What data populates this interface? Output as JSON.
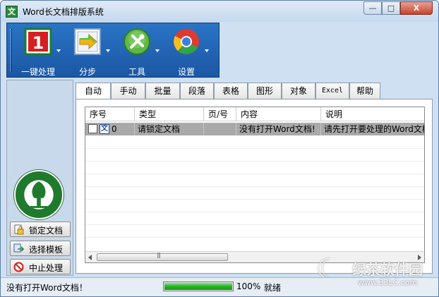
{
  "window": {
    "title": "Word长文档排版系统",
    "app_icon_glyph": "文",
    "controls": {
      "minimize": "—",
      "maximize": "□",
      "close": "X"
    }
  },
  "toolbar": {
    "items": [
      {
        "label": "一键处理",
        "icon": "one-key-icon",
        "icon_text": "1"
      },
      {
        "label": "分步",
        "icon": "step-arrow-icon"
      },
      {
        "label": "工具",
        "icon": "tools-icon"
      },
      {
        "label": "设置",
        "icon": "settings-globe-icon"
      }
    ]
  },
  "left_panel": {
    "logo": "forestry-academy-logo",
    "buttons": [
      {
        "label": "锁定文档",
        "icon": "lock-doc-icon"
      },
      {
        "label": "选择模板",
        "icon": "select-template-icon"
      },
      {
        "label": "中止处理",
        "icon": "stop-icon"
      }
    ]
  },
  "tabs": [
    "自动",
    "手动",
    "批量",
    "段落",
    "表格",
    "图形",
    "对象",
    "Excel",
    "帮助"
  ],
  "active_tab": "自动",
  "table": {
    "columns": [
      "序号",
      "类型",
      "页/号",
      "内容",
      "说明"
    ],
    "rows": [
      {
        "index": "0",
        "doc_icon": "文",
        "type": "请锁定文档",
        "page": "",
        "content": "没有打开Word文档!",
        "note": "请先打开要处理的Word文档"
      }
    ]
  },
  "status": {
    "message": "没有打开Word文档！",
    "progress": 100,
    "progress_text": "100%",
    "state": "就绪"
  },
  "watermark": {
    "text": "绿茶软件园",
    "url": "www.33LC.com"
  },
  "colors": {
    "toolbar_blue": "#1f62b0",
    "panel_bg": "#cfe0f3",
    "selected_row": "#a9a9a9",
    "progress_green": "#22b422",
    "close_red": "#c7432d"
  }
}
